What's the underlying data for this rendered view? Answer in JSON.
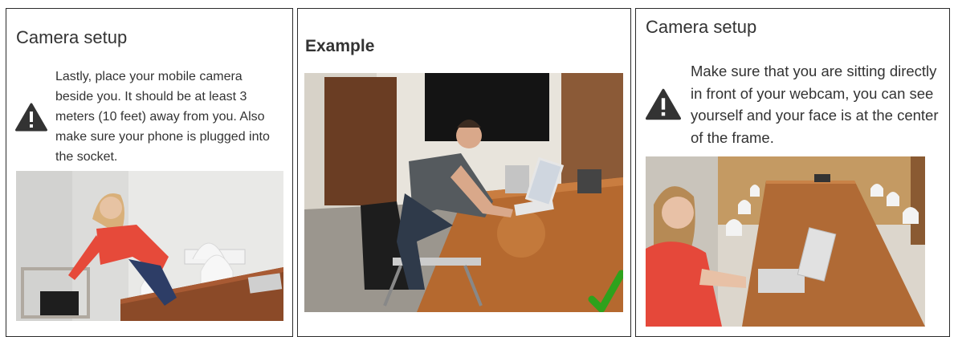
{
  "panels": [
    {
      "title": "Camera setup",
      "notice": "Lastly, place your mobile camera beside you. It should be at least 3 meters (10 feet) away from you. Also make sure your phone is plugged into the socket."
    },
    {
      "title": "Example"
    },
    {
      "title": "Camera setup",
      "notice": "Make sure that you are sitting directly in front of your webcam, you can see yourself and your face is at the center of the frame."
    }
  ],
  "colors": {
    "panel_border": "#2b2b2b",
    "warning_icon": "#333333",
    "checkmark": "#2ea21c"
  },
  "icons": [
    "warning-icon",
    "checkmark-icon"
  ]
}
